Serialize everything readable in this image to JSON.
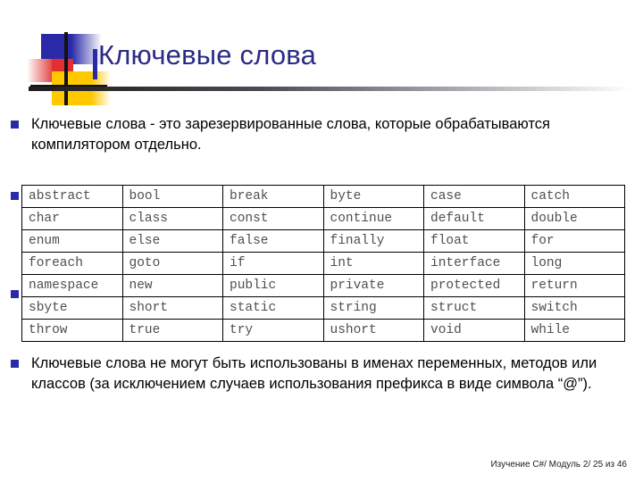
{
  "slide": {
    "title": "Ключевые слова",
    "paragraphs": [
      "Ключевые слова - это зарезервированные слова, которые обрабатываются компилятором отдельно.",
      "Ключевые слова не могут быть использованы в именах переменных, методов или классов (за исключением случаев использования префикса в виде символа “@”)."
    ],
    "footer": "Изучение C#/ Модуль 2/ 25 из 46"
  },
  "colors": {
    "title": "#2b2b86",
    "bullet": "#2a2aa8",
    "logo_blue": "#2a2aa8",
    "logo_red": "#e03030",
    "logo_yellow": "#ffc800",
    "table_text": "#4f4f4f",
    "table_border": "#000000"
  },
  "keyword_table": {
    "columns": 6,
    "rows": [
      [
        "abstract",
        "bool",
        "break",
        "byte",
        "case",
        "catch"
      ],
      [
        "char",
        "class",
        "const",
        "continue",
        "default",
        "double"
      ],
      [
        "enum",
        "else",
        "false",
        "finally",
        "float",
        "for"
      ],
      [
        "foreach",
        "goto",
        "if",
        "int",
        "interface",
        "long"
      ],
      [
        "namespace",
        "new",
        "public",
        "private",
        "protected",
        "return"
      ],
      [
        "sbyte",
        "short",
        "static",
        "string",
        "struct",
        "switch"
      ],
      [
        "throw",
        "true",
        "try",
        "ushort",
        "void",
        "while"
      ]
    ]
  }
}
